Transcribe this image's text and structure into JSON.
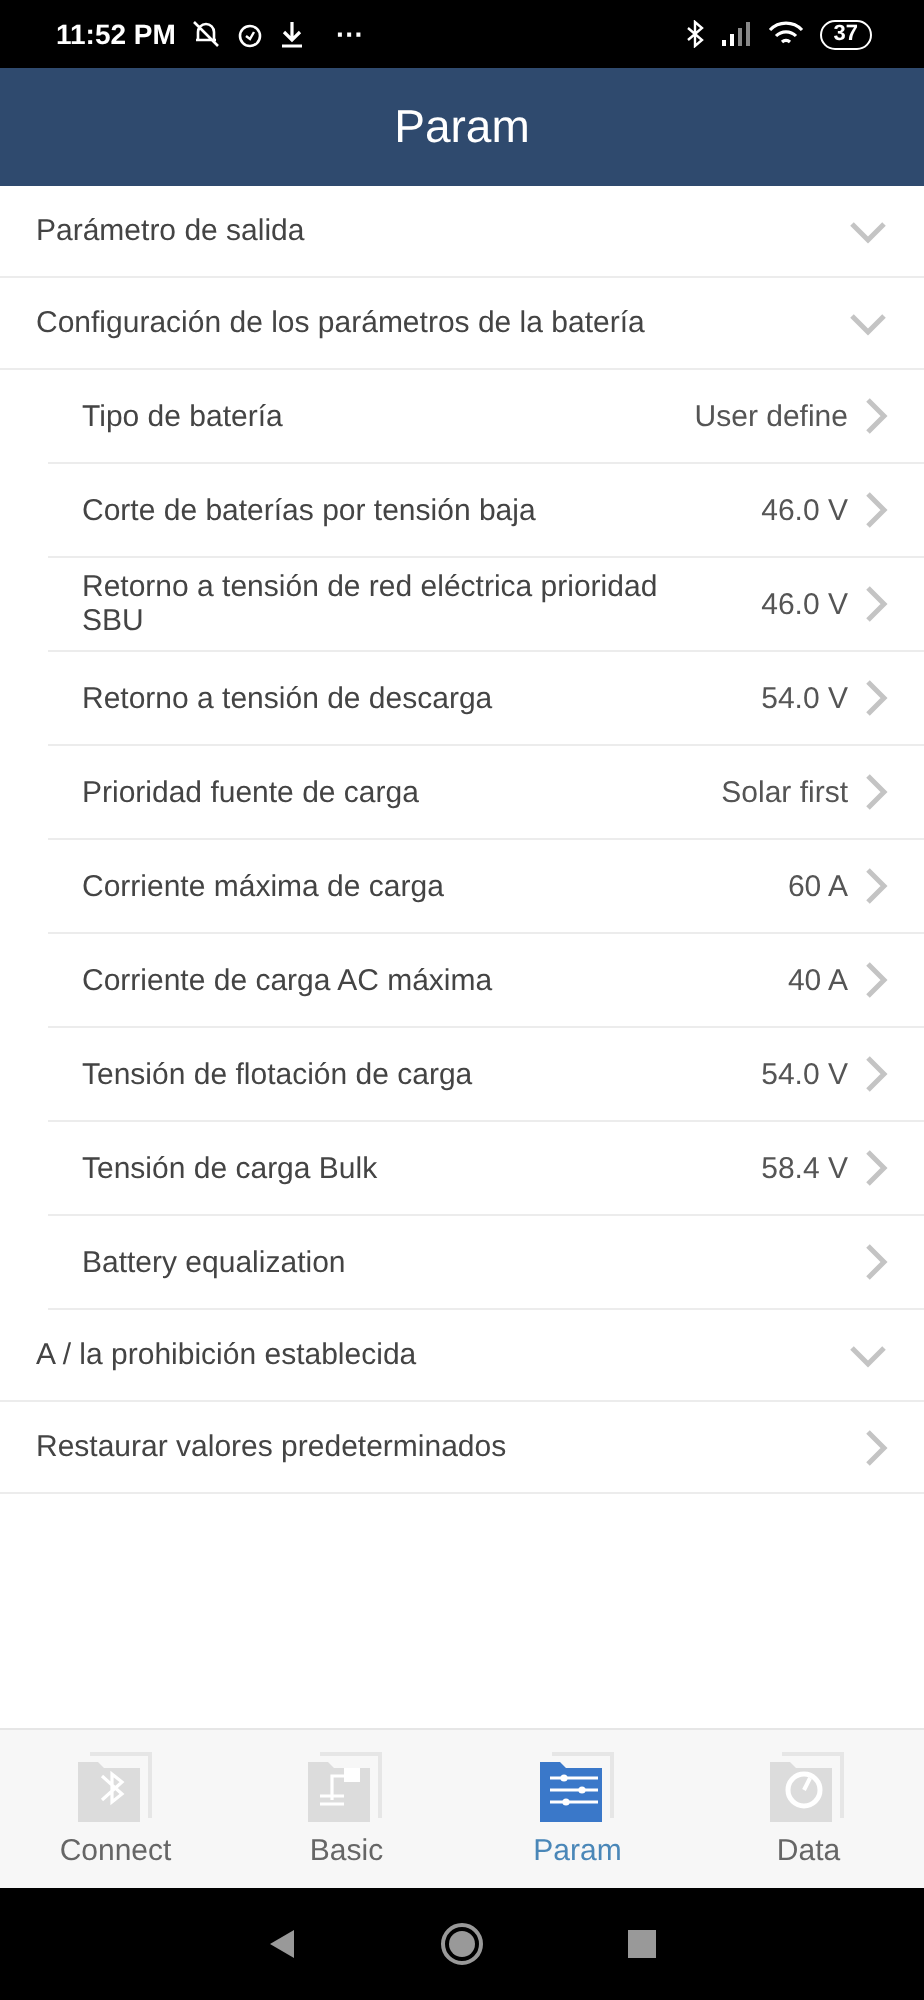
{
  "status_bar": {
    "time": "11:52 PM",
    "more": "···",
    "battery": "37"
  },
  "header": {
    "title": "Param"
  },
  "sections": [
    {
      "label": "Parámetro de salida",
      "kind": "group"
    },
    {
      "label": "Configuración de los parámetros de la batería",
      "kind": "group",
      "children": [
        {
          "label": "Tipo de batería",
          "value": "User define"
        },
        {
          "label": "Corte de baterías por tensión baja",
          "value": "46.0 V"
        },
        {
          "label": "Retorno a tensión de red eléctrica prioridad SBU",
          "value": "46.0 V"
        },
        {
          "label": "Retorno a tensión de descarga",
          "value": "54.0 V"
        },
        {
          "label": "Prioridad fuente de carga",
          "value": "Solar first"
        },
        {
          "label": "Corriente máxima de carga",
          "value": "60 A"
        },
        {
          "label": "Corriente de carga AC máxima",
          "value": "40 A"
        },
        {
          "label": "Tensión de flotación de carga",
          "value": "54.0 V"
        },
        {
          "label": "Tensión de carga Bulk",
          "value": "58.4 V"
        },
        {
          "label": "Battery equalization"
        }
      ]
    },
    {
      "label": "A / la prohibición establecida",
      "kind": "group"
    },
    {
      "label": "Restaurar valores predeterminados",
      "kind": "action"
    }
  ],
  "tabs": [
    {
      "label": "Connect",
      "kind": "bluetooth",
      "selected": false
    },
    {
      "label": "Basic",
      "kind": "diagram",
      "selected": false
    },
    {
      "label": "Param",
      "kind": "sliders",
      "selected": true
    },
    {
      "label": "Data",
      "kind": "gauge",
      "selected": false
    }
  ]
}
